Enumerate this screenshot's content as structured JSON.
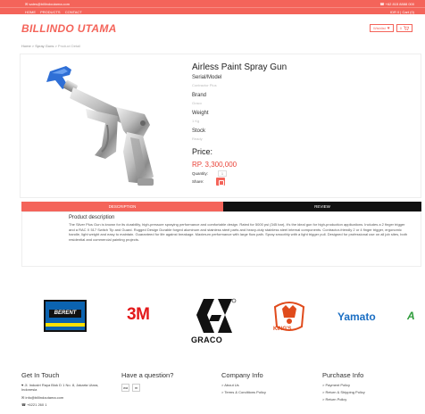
{
  "topbar": {
    "email": "✉ sales@billindoutama.com",
    "phone": "☎ +62 815 8888 000"
  },
  "nav": {
    "links": [
      "HOME",
      "PRODUCTS",
      "CONTACT"
    ],
    "cart_total": "IDR 0 | Cart (0)"
  },
  "header": {
    "brand": "BILLINDO UTAMA",
    "wishlist_label": "Wishlist",
    "wishlist_icon": "heart-icon",
    "cart_label": "0",
    "cart_icon": "cart-icon"
  },
  "breadcrumb": {
    "home": "Home",
    "sep1": " > ",
    "section": "Spray Guns",
    "sep2": " > ",
    "current": "Product Detail"
  },
  "product": {
    "title": "Airless Paint Spray Gun",
    "serial_label": "Serial/Model",
    "serial_value": "Contractor Plus",
    "brand_label": "Brand",
    "brand_value": "Graco",
    "weight_label": "Weight",
    "weight_value": "1 Kg",
    "stock_label": "Stock",
    "stock_value": "Ready",
    "price_label": "Price:",
    "price_value": "RP. 3,300,000",
    "quantity_label": "Quantity:",
    "quantity_value": "1",
    "share_label": "Share:"
  },
  "tabs": {
    "description": "DESCRIPTION",
    "review": "REVIEW"
  },
  "description": {
    "title": "Product description",
    "text": "The Silver Plus Gun is known for its durability, high-pressure spraying performance and comfortable design. Rated for 5000 psi (345 bar), it's the ideal gun for high-production applications. Includes a 2 finger trigger and a RAC X 517 Switch Tip and Guard. Rugged Design Durable forged aluminum and stainless steel parts and heavy-duty stainless steel internal components. Contractor-friendly 2 or 4 finger trigger, ergonomic handle, light weight and easy to maintain. Guaranteed for life against breakage. Maximum performance with large flow path. Spray smoothly with a light trigger pull. Designed for professional use on all job sites, both residential and commercial painting projects."
  },
  "brands": {
    "berent": "BERENT",
    "three_m": "3M",
    "graco": "GRACO",
    "kings": "KING'S",
    "yamato": "Yamato",
    "last": "A"
  },
  "footer": {
    "get_in_touch": {
      "title": "Get In Touch",
      "address": "♥ Jl. Industri Raya Blok D 1 No. 8, Jakarta Utara, Indonesia",
      "email": "✉ info@billindoutama.com",
      "phone": "☎ +6221 260 1"
    },
    "question": {
      "title": "Have a question?",
      "btn1": "wa",
      "btn2": "m"
    },
    "company": {
      "title": "Company Info",
      "items": [
        "> About Us",
        "> Terms & Conditions Policy"
      ]
    },
    "purchase": {
      "title": "Purchase Info",
      "items": [
        "> Payment Policy",
        "> Return & Shipping Policy",
        "> Return Policy"
      ]
    }
  },
  "colors": {
    "accent": "#f4645a",
    "dark": "#111111",
    "price": "#e9443a"
  }
}
